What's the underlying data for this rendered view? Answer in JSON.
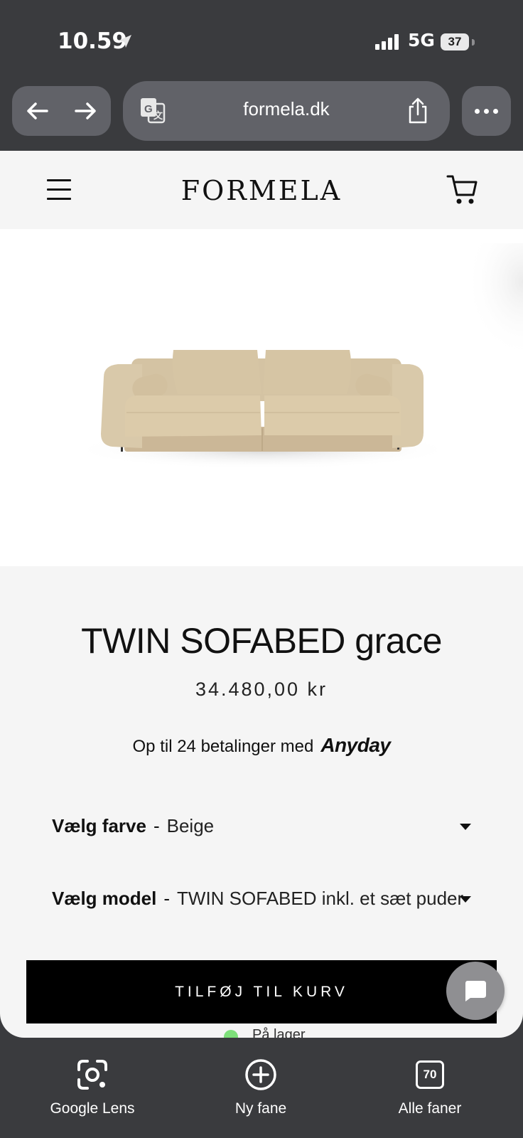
{
  "status_bar": {
    "time": "10.59",
    "network": "5G",
    "battery": "37"
  },
  "browser": {
    "url": "formela.dk"
  },
  "site": {
    "logo": "FORMELA"
  },
  "product": {
    "title": "TWIN SOFABED grace",
    "price": "34.480,00 kr",
    "installments_text": "Op til 24 betalinger med",
    "installments_provider": "Anyday",
    "options": [
      {
        "label": "Vælg farve",
        "separator": "-",
        "value": "Beige"
      },
      {
        "label": "Vælg model",
        "separator": "-",
        "value": "TWIN SOFABED inkl. et sæt puder"
      }
    ],
    "add_to_cart": "TILFØJ TIL KURV",
    "stock": "På lager"
  },
  "bottom_toolbar": {
    "items": [
      {
        "label": "Google Lens"
      },
      {
        "label": "Ny fane"
      },
      {
        "label": "Alle faner",
        "count": "70"
      }
    ]
  },
  "colors": {
    "sofa": "#d8c7a8",
    "stock_dot": "#7ee07a"
  }
}
